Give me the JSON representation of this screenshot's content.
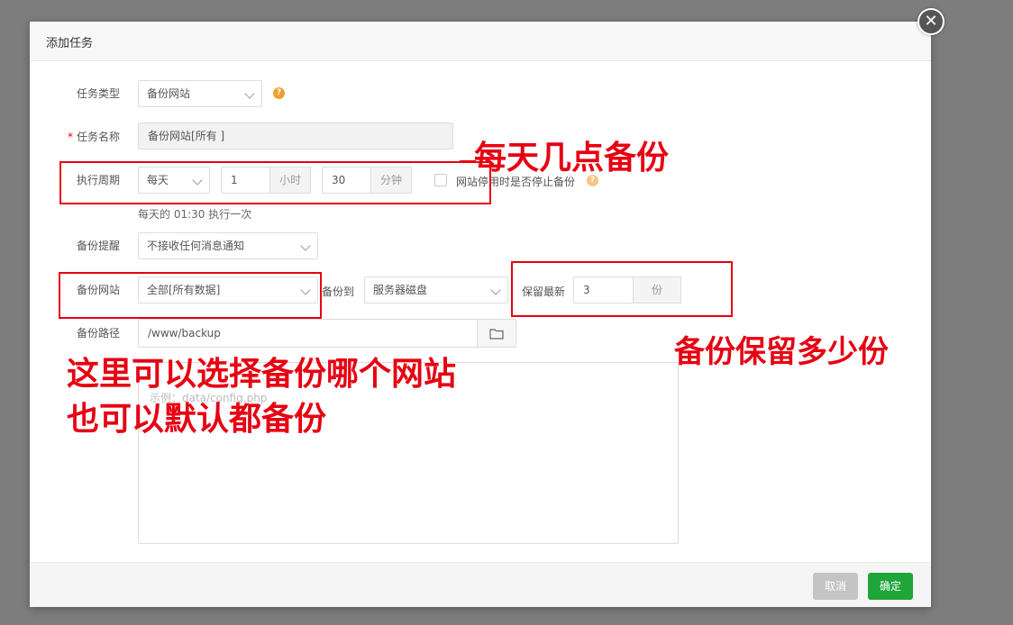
{
  "dialog": {
    "title": "添加任务",
    "close_glyph": "✕"
  },
  "form": {
    "task_type": {
      "label": "任务类型",
      "value": "备份网站",
      "help": "?"
    },
    "task_name": {
      "required_mark": "*",
      "label": "任务名称",
      "value": "备份网站[所有 ]"
    },
    "period": {
      "label": "执行周期",
      "frequency": "每天",
      "hour": "1",
      "hour_unit": "小时",
      "minute": "30",
      "minute_unit": "分钟",
      "stop_site_label": "网站停用时是否停止备份",
      "summary": "每天的 01:30 执行一次"
    },
    "reminder": {
      "label": "备份提醒",
      "value": "不接收任何消息通知"
    },
    "backup_site": {
      "label": "备份网站",
      "value": "全部[所有数据]",
      "target_label": "备份到",
      "target_value": "服务器磁盘",
      "keep_label": "保留最新",
      "keep_value": "3",
      "keep_unit": "份"
    },
    "backup_path": {
      "label": "备份路径",
      "value": "/www/backup"
    },
    "exclude": {
      "placeholder": "示例：data/config.php"
    }
  },
  "footer": {
    "cancel_label": "取消",
    "ok_label": "确定"
  },
  "annotations": {
    "time": "每天几点备份",
    "keep": "备份保留多少份",
    "site_line1": "这里可以选择备份哪个网站",
    "site_line2": "也可以默认都备份"
  },
  "colors": {
    "accent_red": "#e60012",
    "primary_green": "#20a53a",
    "help_orange": "#f0a030"
  }
}
